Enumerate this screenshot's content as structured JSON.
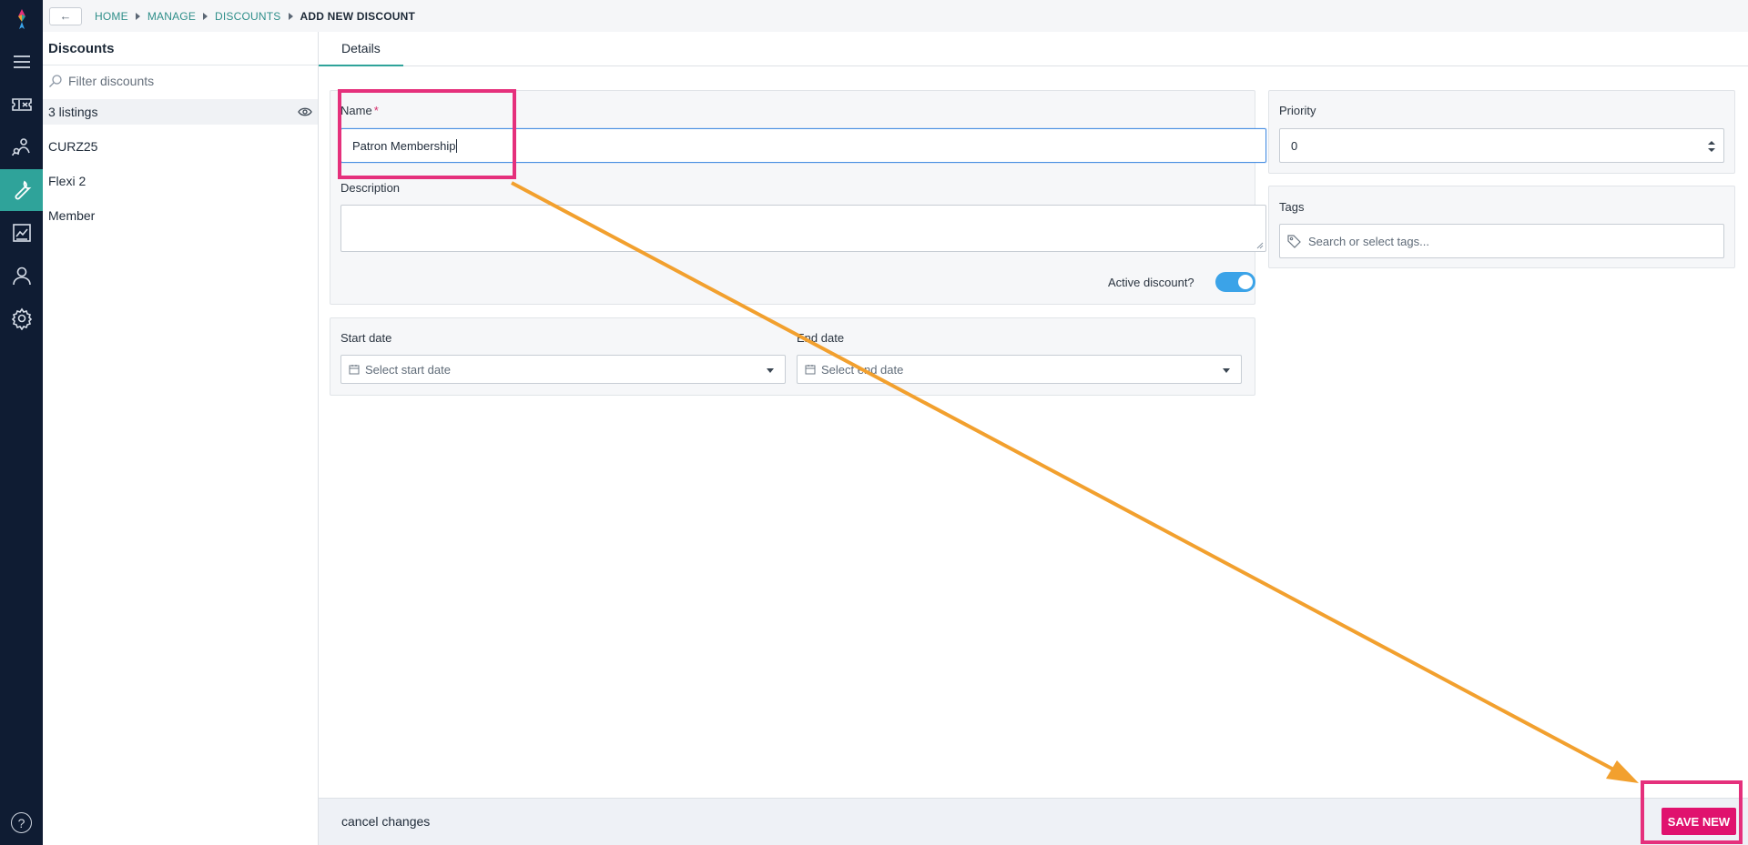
{
  "nav_rail": {
    "items": [
      {
        "name": "menu-icon"
      },
      {
        "name": "tickets-icon"
      },
      {
        "name": "people-icon"
      },
      {
        "name": "wrench-icon",
        "active": true
      },
      {
        "name": "reports-icon"
      },
      {
        "name": "user-icon"
      },
      {
        "name": "settings-icon"
      }
    ],
    "help_label": "?"
  },
  "breadcrumb": {
    "back_label": "←",
    "items": [
      "HOME",
      "MANAGE",
      "DISCOUNTS",
      "ADD NEW DISCOUNT"
    ]
  },
  "list": {
    "title": "Discounts",
    "filter_placeholder": "Filter discounts",
    "count_label": "3 listings",
    "items": [
      "CURZ25",
      "Flexi 2",
      "Member"
    ]
  },
  "tabs": [
    "Details"
  ],
  "form": {
    "name_label": "Name",
    "name_required_mark": "*",
    "name_value": "Patron Membership",
    "description_label": "Description",
    "description_value": "",
    "active_label": "Active discount?",
    "active_on": true,
    "start_date_label": "Start date",
    "start_date_placeholder": "Select start date",
    "end_date_label": "End date",
    "end_date_placeholder": "Select end date",
    "priority_label": "Priority",
    "priority_value": "0",
    "tags_label": "Tags",
    "tags_placeholder": "Search or select tags..."
  },
  "actions": {
    "cancel_label": "cancel changes",
    "save_label": "SAVE NEW"
  },
  "colors": {
    "rail_bg": "#0f1c33",
    "accent_teal": "#2fa39a",
    "save_pink": "#e0126e",
    "toggle_blue": "#3ba3e8",
    "annotation_pink": "#e5307c",
    "annotation_orange": "#f2a02e"
  }
}
